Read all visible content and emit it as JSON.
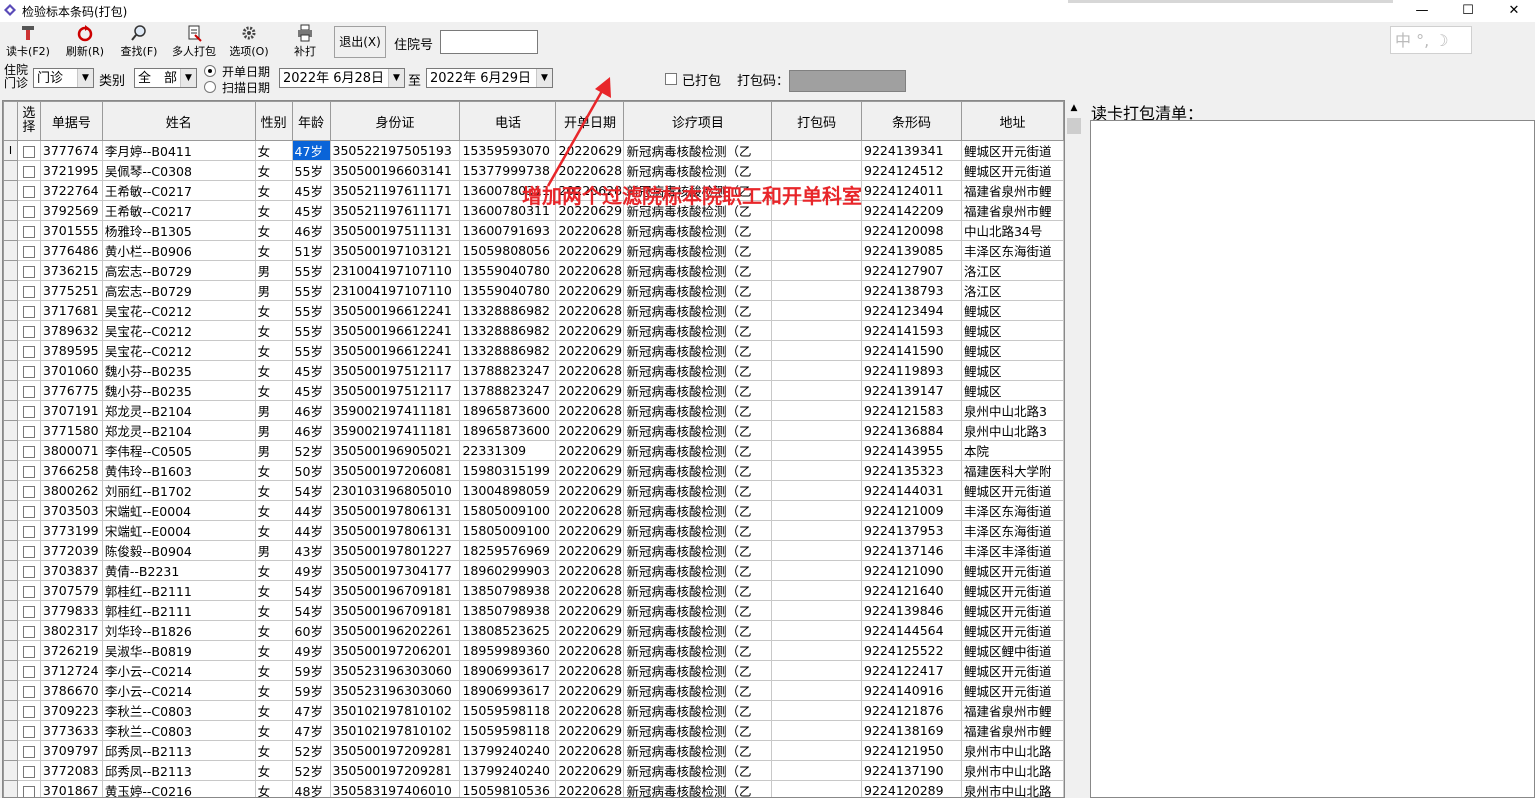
{
  "window": {
    "title": "检验标本条码(打包)",
    "min": "—",
    "max": "☐",
    "close": "✕"
  },
  "toolbar": {
    "buttons": [
      {
        "label": "读卡(F2)",
        "icon": "card-reader-icon"
      },
      {
        "label": "刷新(R)",
        "icon": "refresh-icon"
      },
      {
        "label": "查找(F)",
        "icon": "search-icon"
      },
      {
        "label": "多人打包",
        "icon": "multi-package-icon"
      },
      {
        "label": "选项(O)",
        "icon": "gear-icon"
      },
      {
        "label": "补打",
        "icon": "printer-icon"
      }
    ],
    "exit_label": "退出(X)",
    "inpatient_label": "住院号",
    "inpatient_value": "",
    "ime_text": "中 °, ☽"
  },
  "filters": {
    "source_label_top": "住院",
    "source_label_bottom": "门诊",
    "source_value": "门诊",
    "category_label": "类别",
    "category_value": "全　部",
    "radio_order_date": "开单日期",
    "radio_scan_date": "扫描日期",
    "date_from": "2022年 6月28日",
    "date_to_label": "至",
    "date_to": "2022年 6月29日",
    "packed_label": "已打包",
    "package_code_label": "打包码："
  },
  "table": {
    "columns": [
      "选择",
      "单据号",
      "姓名",
      "性别",
      "年龄",
      "身份证",
      "电话",
      "开单日期",
      "诊疗项目",
      "打包码",
      "条形码",
      "地址"
    ],
    "rows": [
      [
        "3777674",
        "李月婷--B0411",
        "女",
        "47岁",
        "350522197505193",
        "15359593070",
        "20220629",
        "新冠病毒核酸检测（乙",
        "",
        "9224139341",
        "鲤城区开元街道"
      ],
      [
        "3721995",
        "吴佩琴--C0308",
        "女",
        "55岁",
        "350500196603141",
        "15377999738",
        "20220628",
        "新冠病毒核酸检测（乙",
        "",
        "9224124512",
        "鲤城区开元街道"
      ],
      [
        "3722764",
        "王希敏--C0217",
        "女",
        "45岁",
        "350521197611171",
        "13600780311",
        "20220628",
        "新冠病毒核酸检测（乙",
        "",
        "9224124011",
        "福建省泉州市鲤"
      ],
      [
        "3792569",
        "王希敏--C0217",
        "女",
        "45岁",
        "350521197611171",
        "13600780311",
        "20220629",
        "新冠病毒核酸检测（乙",
        "",
        "9224142209",
        "福建省泉州市鲤"
      ],
      [
        "3701555",
        "杨雅玲--B1305",
        "女",
        "46岁",
        "350500197511131",
        "13600791693",
        "20220628",
        "新冠病毒核酸检测（乙",
        "",
        "9224120098",
        "中山北路34号"
      ],
      [
        "3776486",
        "黄小栏--B0906",
        "女",
        "51岁",
        "350500197103121",
        "15059808056",
        "20220629",
        "新冠病毒核酸检测（乙",
        "",
        "9224139085",
        "丰泽区东海街道"
      ],
      [
        "3736215",
        "高宏志--B0729",
        "男",
        "55岁",
        "231004197107110",
        "13559040780",
        "20220628",
        "新冠病毒核酸检测（乙",
        "",
        "9224127907",
        "洛江区"
      ],
      [
        "3775251",
        "高宏志--B0729",
        "男",
        "55岁",
        "231004197107110",
        "13559040780",
        "20220629",
        "新冠病毒核酸检测（乙",
        "",
        "9224138793",
        "洛江区"
      ],
      [
        "3717681",
        "吴宝花--C0212",
        "女",
        "55岁",
        "350500196612241",
        "13328886982",
        "20220628",
        "新冠病毒核酸检测（乙",
        "",
        "9224123494",
        "鲤城区"
      ],
      [
        "3789632",
        "吴宝花--C0212",
        "女",
        "55岁",
        "350500196612241",
        "13328886982",
        "20220629",
        "新冠病毒核酸检测（乙",
        "",
        "9224141593",
        "鲤城区"
      ],
      [
        "3789595",
        "吴宝花--C0212",
        "女",
        "55岁",
        "350500196612241",
        "13328886982",
        "20220629",
        "新冠病毒核酸检测（乙",
        "",
        "9224141590",
        "鲤城区"
      ],
      [
        "3701060",
        "魏小芬--B0235",
        "女",
        "45岁",
        "350500197512117",
        "13788823247",
        "20220628",
        "新冠病毒核酸检测（乙",
        "",
        "9224119893",
        "鲤城区"
      ],
      [
        "3776775",
        "魏小芬--B0235",
        "女",
        "45岁",
        "350500197512117",
        "13788823247",
        "20220629",
        "新冠病毒核酸检测（乙",
        "",
        "9224139147",
        "鲤城区"
      ],
      [
        "3707191",
        "郑龙灵--B2104",
        "男",
        "46岁",
        "359002197411181",
        "18965873600",
        "20220628",
        "新冠病毒核酸检测（乙",
        "",
        "9224121583",
        "泉州中山北路3"
      ],
      [
        "3771580",
        "郑龙灵--B2104",
        "男",
        "46岁",
        "359002197411181",
        "18965873600",
        "20220629",
        "新冠病毒核酸检测（乙",
        "",
        "9224136884",
        "泉州中山北路3"
      ],
      [
        "3800071",
        "李伟程--C0505",
        "男",
        "52岁",
        "350500196905021",
        "22331309",
        "20220629",
        "新冠病毒核酸检测（乙",
        "",
        "9224143955",
        "本院"
      ],
      [
        "3766258",
        "黄伟玲--B1603",
        "女",
        "50岁",
        "350500197206081",
        "15980315199",
        "20220629",
        "新冠病毒核酸检测（乙",
        "",
        "9224135323",
        "福建医科大学附"
      ],
      [
        "3800262",
        "刘丽红--B1702",
        "女",
        "54岁",
        "230103196805010",
        "13004898059",
        "20220629",
        "新冠病毒核酸检测（乙",
        "",
        "9224144031",
        "鲤城区开元街道"
      ],
      [
        "3703503",
        "宋端虹--E0004",
        "女",
        "44岁",
        "350500197806131",
        "15805009100",
        "20220628",
        "新冠病毒核酸检测（乙",
        "",
        "9224121009",
        "丰泽区东海街道"
      ],
      [
        "3773199",
        "宋端虹--E0004",
        "女",
        "44岁",
        "350500197806131",
        "15805009100",
        "20220629",
        "新冠病毒核酸检测（乙",
        "",
        "9224137953",
        "丰泽区东海街道"
      ],
      [
        "3772039",
        "陈俊毅--B0904",
        "男",
        "43岁",
        "350500197801227",
        "18259576969",
        "20220629",
        "新冠病毒核酸检测（乙",
        "",
        "9224137146",
        "丰泽区丰泽街道"
      ],
      [
        "3703837",
        "黄倩--B2231",
        "女",
        "49岁",
        "350500197304177",
        "18960299903",
        "20220628",
        "新冠病毒核酸检测（乙",
        "",
        "9224121090",
        "鲤城区开元街道"
      ],
      [
        "3707579",
        "郭桂红--B2111",
        "女",
        "54岁",
        "350500196709181",
        "13850798938",
        "20220628",
        "新冠病毒核酸检测（乙",
        "",
        "9224121640",
        "鲤城区开元街道"
      ],
      [
        "3779833",
        "郭桂红--B2111",
        "女",
        "54岁",
        "350500196709181",
        "13850798938",
        "20220629",
        "新冠病毒核酸检测（乙",
        "",
        "9224139846",
        "鲤城区开元街道"
      ],
      [
        "3802317",
        "刘华玲--B1826",
        "女",
        "60岁",
        "350500196202261",
        "13808523625",
        "20220629",
        "新冠病毒核酸检测（乙",
        "",
        "9224144564",
        "鲤城区开元街道"
      ],
      [
        "3726219",
        "吴淑华--B0819",
        "女",
        "49岁",
        "350500197206201",
        "18959989360",
        "20220628",
        "新冠病毒核酸检测（乙",
        "",
        "9224125522",
        "鲤城区鲤中街道"
      ],
      [
        "3712724",
        "李小云--C0214",
        "女",
        "59岁",
        "350523196303060",
        "18906993617",
        "20220628",
        "新冠病毒核酸检测（乙",
        "",
        "9224122417",
        "鲤城区开元街道"
      ],
      [
        "3786670",
        "李小云--C0214",
        "女",
        "59岁",
        "350523196303060",
        "18906993617",
        "20220629",
        "新冠病毒核酸检测（乙",
        "",
        "9224140916",
        "鲤城区开元街道"
      ],
      [
        "3709223",
        "李秋兰--C0803",
        "女",
        "47岁",
        "350102197810102",
        "15059598118",
        "20220628",
        "新冠病毒核酸检测（乙",
        "",
        "9224121876",
        "福建省泉州市鲤"
      ],
      [
        "3773633",
        "李秋兰--C0803",
        "女",
        "47岁",
        "350102197810102",
        "15059598118",
        "20220629",
        "新冠病毒核酸检测（乙",
        "",
        "9224138169",
        "福建省泉州市鲤"
      ],
      [
        "3709797",
        "邱秀凤--B2113",
        "女",
        "52岁",
        "350500197209281",
        "13799240240",
        "20220628",
        "新冠病毒核酸检测（乙",
        "",
        "9224121950",
        "泉州市中山北路"
      ],
      [
        "3772083",
        "邱秀凤--B2113",
        "女",
        "52岁",
        "350500197209281",
        "13799240240",
        "20220629",
        "新冠病毒核酸检测（乙",
        "",
        "9224137190",
        "泉州市中山北路"
      ],
      [
        "3701867",
        "黄玉婷--C0216",
        "女",
        "48岁",
        "350583197406010",
        "15059810536",
        "20220628",
        "新冠病毒核酸检测（乙",
        "",
        "9224120289",
        "泉州市中山北路"
      ]
    ]
  },
  "right_panel": {
    "title": "读卡打包清单："
  },
  "annotation": {
    "text": "增加两个过滤院标本院职工和开单科室",
    "color": "#e8262a"
  }
}
